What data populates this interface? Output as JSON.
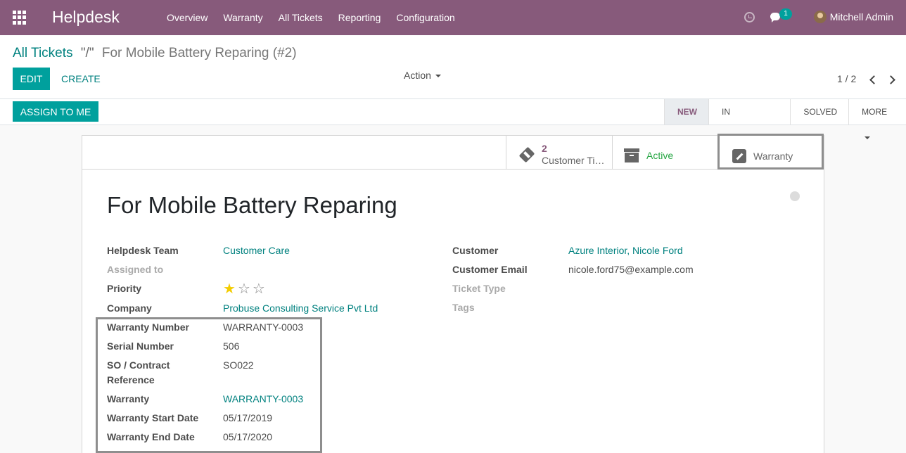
{
  "navbar": {
    "brand": "Helpdesk",
    "menu": [
      "Overview",
      "Warranty",
      "All Tickets",
      "Reporting",
      "Configuration"
    ],
    "chat_count": "1",
    "user_name": "Mitchell Admin"
  },
  "breadcrumb": {
    "parent": "All Tickets",
    "separator": "\"/\"",
    "current": "For Mobile Battery Reparing (#2)"
  },
  "toolbar": {
    "edit_label": "EDIT",
    "create_label": "CREATE",
    "action_label": "Action",
    "pager": "1 / 2"
  },
  "header": {
    "assign_label": "ASSIGN TO ME",
    "stages": [
      "NEW",
      "IN PROGRESS",
      "SOLVED"
    ],
    "active_stage": "NEW",
    "more_label": "MORE"
  },
  "smart_buttons": {
    "tickets_count": "2",
    "tickets_label": "Customer Tickets",
    "active_label": "Active",
    "warranty_label": "Warranty"
  },
  "ticket": {
    "title": "For Mobile Battery Reparing",
    "left": {
      "team_label": "Helpdesk Team",
      "team_value": "Customer Care",
      "assigned_label": "Assigned to",
      "priority_label": "Priority",
      "priority_stars": 1,
      "company_label": "Company",
      "company_value": "Probuse Consulting Service Pvt Ltd",
      "warranty_number_label": "Warranty Number",
      "warranty_number_value": "WARRANTY-0003",
      "serial_label": "Serial Number",
      "serial_value": "506",
      "so_label_1": "SO / Contract",
      "so_label_2": "Reference",
      "so_value": "SO022",
      "warranty_label": "Warranty",
      "warranty_value": "WARRANTY-0003",
      "start_label": "Warranty Start Date",
      "start_value": "05/17/2019",
      "end_label": "Warranty End Date",
      "end_value": "05/17/2020"
    },
    "right": {
      "customer_label": "Customer",
      "customer_value": "Azure Interior, Nicole Ford",
      "email_label": "Customer Email",
      "email_value": "nicole.ford75@example.com",
      "type_label": "Ticket Type",
      "tags_label": "Tags"
    }
  },
  "colors": {
    "navbar": "#875a7b",
    "primary": "#00a09d",
    "link": "#00817f",
    "active_green": "#28a745",
    "star": "#f3cc00"
  }
}
